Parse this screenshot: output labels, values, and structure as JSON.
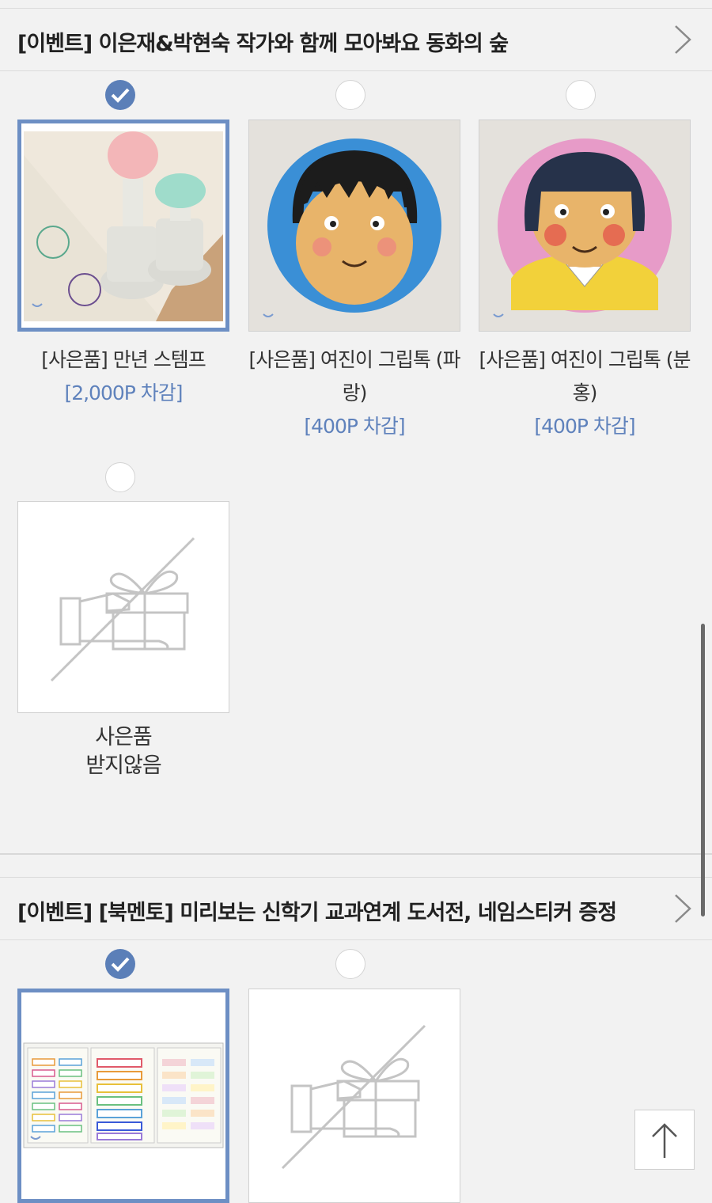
{
  "events": [
    {
      "title": "[이벤트] 이은재&박현숙 작가와 함께 모아봐요 동화의 숲",
      "gifts": [
        {
          "label": "[사은품] 만년 스템프",
          "price": "[2,000P 차감]",
          "selected": true,
          "image": "stamp-photo"
        },
        {
          "label_line1": "[사은품] 여진이 그립톡 (파",
          "label_line2": "랑)",
          "price": "[400P 차감]",
          "selected": false,
          "image": "griptok-blue"
        },
        {
          "label_line1": "[사은품] 여진이 그립톡 (분",
          "label_line2": "홍)",
          "price": "[400P 차감]",
          "selected": false,
          "image": "griptok-pink"
        },
        {
          "label_line1": "사은품",
          "label_line2": "받지않음",
          "selected": false,
          "image": "no-gift-icon"
        }
      ]
    },
    {
      "title": "[이벤트] [북멘토] 미리보는 신학기 교과연계 도서전, 네임스티커 증정",
      "gifts": [
        {
          "selected": true,
          "image": "name-sticker-sheet"
        },
        {
          "selected": false,
          "image": "no-gift-icon"
        }
      ]
    }
  ],
  "colors": {
    "accent": "#5b7fb8",
    "price": "#5f82bc",
    "background": "#f2f2f2"
  }
}
